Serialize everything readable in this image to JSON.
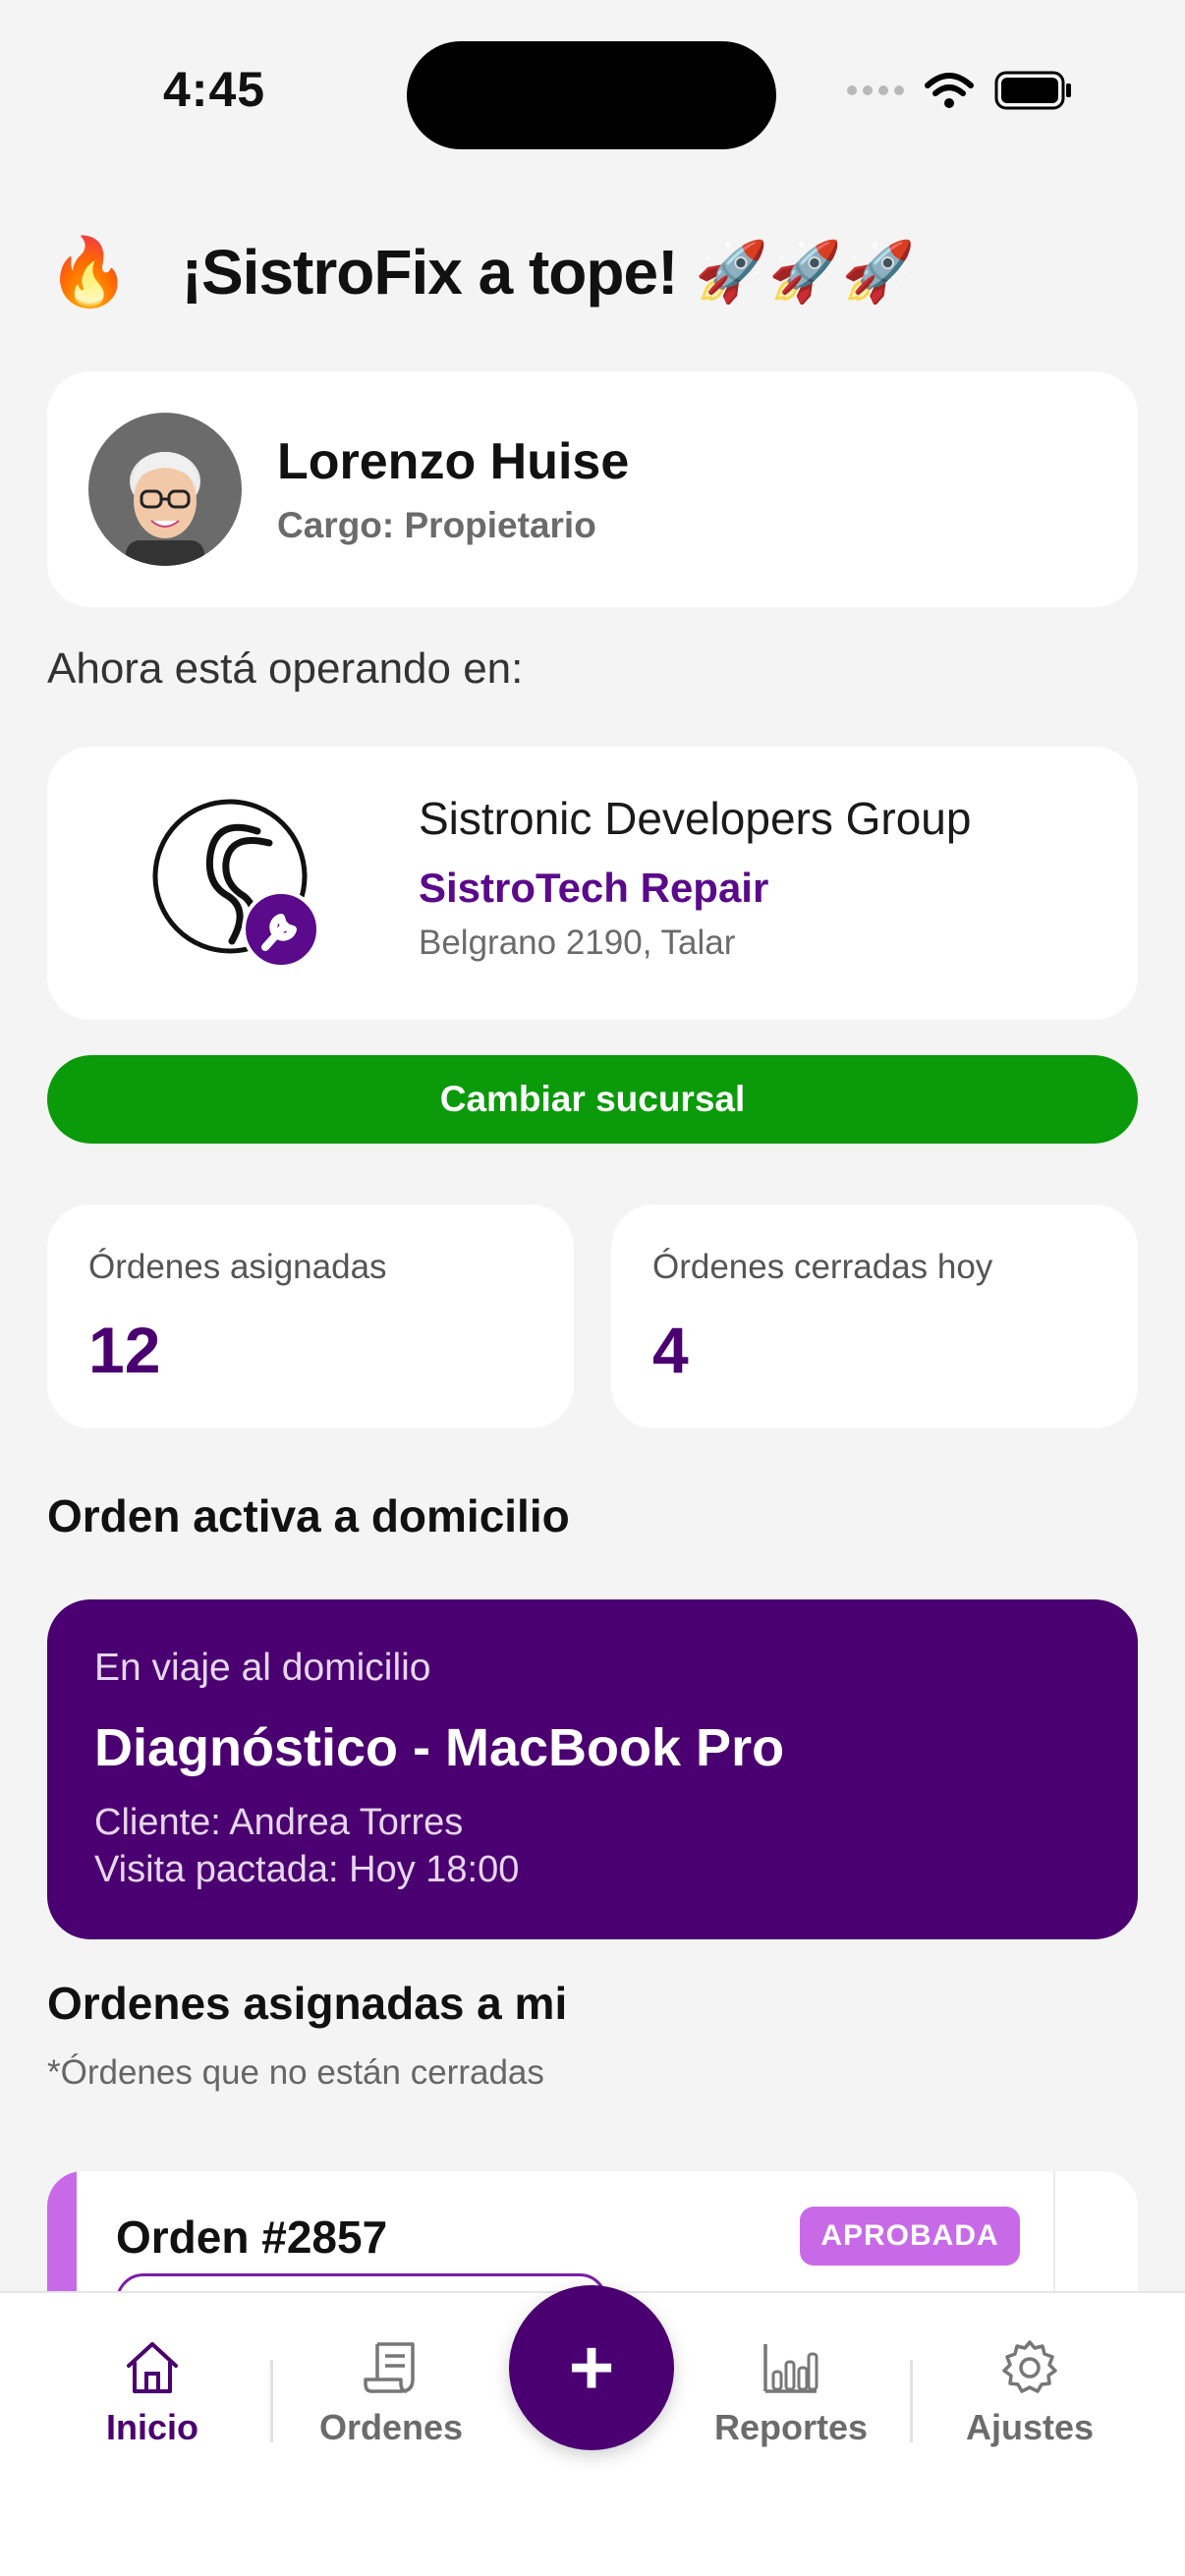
{
  "status_bar": {
    "time": "4:45"
  },
  "header": {
    "title": "¡SistroFix a tope!",
    "prefix_emoji": "🔥",
    "suffix_emoji": "🚀🚀🚀"
  },
  "profile": {
    "name": "Lorenzo Huise",
    "role": "Cargo: Propietario"
  },
  "operating": {
    "label": "Ahora está operando en:",
    "company": "Sistronic Developers Group",
    "branch": "SistroTech Repair",
    "address": "Belgrano 2190, Talar"
  },
  "change_branch_label": "Cambiar sucursal",
  "stats": [
    {
      "label": "Órdenes asignadas",
      "value": "12"
    },
    {
      "label": "Órdenes cerradas hoy",
      "value": "4"
    }
  ],
  "active_order": {
    "section_title": "Orden activa a domicilio",
    "status": "En viaje al domicilio",
    "title": "Diagnóstico - MacBook Pro",
    "client": "Cliente: Andrea Torres",
    "visit": "Visita pactada: Hoy 18:00"
  },
  "assigned": {
    "section_title": "Ordenes asignadas a mi",
    "subtitle": "*Órdenes que no están cerradas",
    "orders": [
      {
        "title": "Orden #2857",
        "badge": "APROBADA"
      }
    ]
  },
  "tabbar": {
    "tabs": [
      {
        "label": "Inicio",
        "icon": "home-icon"
      },
      {
        "label": "Ordenes",
        "icon": "orders-icon"
      },
      {
        "label": "Reportes",
        "icon": "reports-icon"
      },
      {
        "label": "Ajustes",
        "icon": "settings-icon"
      }
    ],
    "fab_label": "+"
  },
  "colors": {
    "accent": "#4a0070",
    "branch_text": "#5a0a8a",
    "button_green": "#0a9a0a",
    "badge": "#c86ae8",
    "background": "#f4f4f4"
  }
}
